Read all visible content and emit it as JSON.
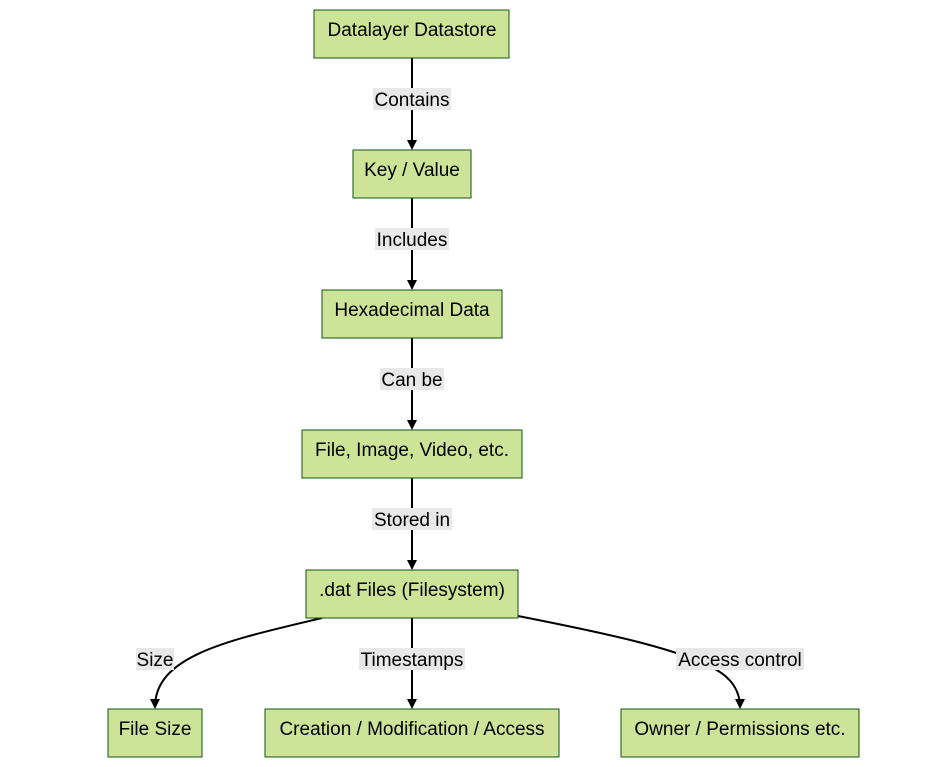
{
  "diagram": {
    "type": "flowchart",
    "direction": "top-to-bottom",
    "colors": {
      "node_fill": "#cde498",
      "node_stroke": "#13540c",
      "edge": "#000000",
      "label_bg": "#e8e8e8"
    },
    "nodes": [
      {
        "id": "datastore",
        "label": "Datalayer Datastore"
      },
      {
        "id": "kv",
        "label": "Key / Value"
      },
      {
        "id": "hex",
        "label": "Hexadecimal Data"
      },
      {
        "id": "media",
        "label": "File, Image, Video, etc."
      },
      {
        "id": "dat",
        "label": ".dat Files (Filesystem)"
      },
      {
        "id": "size",
        "label": "File Size"
      },
      {
        "id": "times",
        "label": "Creation / Modification / Access"
      },
      {
        "id": "owner",
        "label": "Owner / Permissions etc."
      }
    ],
    "edges": [
      {
        "from": "datastore",
        "to": "kv",
        "label": "Contains"
      },
      {
        "from": "kv",
        "to": "hex",
        "label": "Includes"
      },
      {
        "from": "hex",
        "to": "media",
        "label": "Can be"
      },
      {
        "from": "media",
        "to": "dat",
        "label": "Stored in"
      },
      {
        "from": "dat",
        "to": "size",
        "label": "Size"
      },
      {
        "from": "dat",
        "to": "times",
        "label": "Timestamps"
      },
      {
        "from": "dat",
        "to": "owner",
        "label": "Access control"
      }
    ]
  }
}
